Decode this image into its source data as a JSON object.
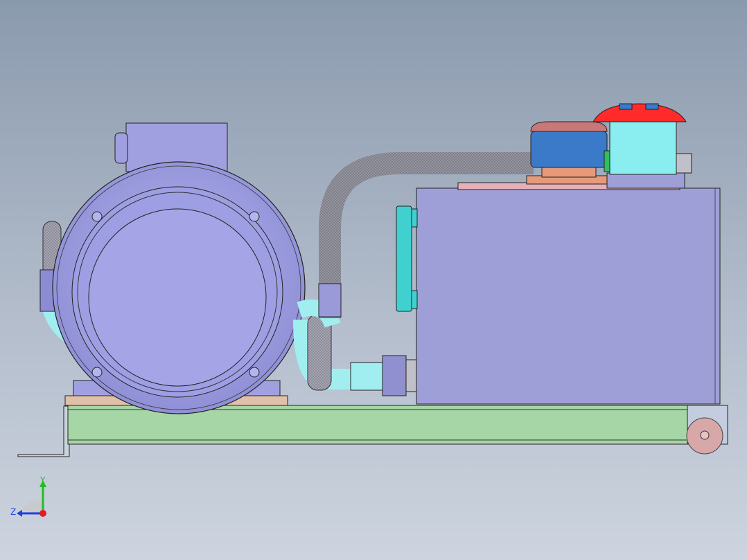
{
  "viewport": {
    "background_top": "#8a9aad",
    "background_bottom": "#cdd4df"
  },
  "model": {
    "motor_color": "#a0a0e0",
    "tank_color": "#9f9fd8",
    "base_rail_color": "#a6d6a6",
    "pipe_color": "#a8a8b8",
    "fitting_color": "#a0eef0",
    "filter_cap_color": "#ff2a2a",
    "breather_color": "#3a7ac8",
    "flange_color": "#e69a7a"
  },
  "triad": {
    "y_label": "Y",
    "z_label": "Z",
    "y_color": "#1fbf1f",
    "z_color": "#1f3fdf",
    "x_color": "#df1f1f"
  }
}
